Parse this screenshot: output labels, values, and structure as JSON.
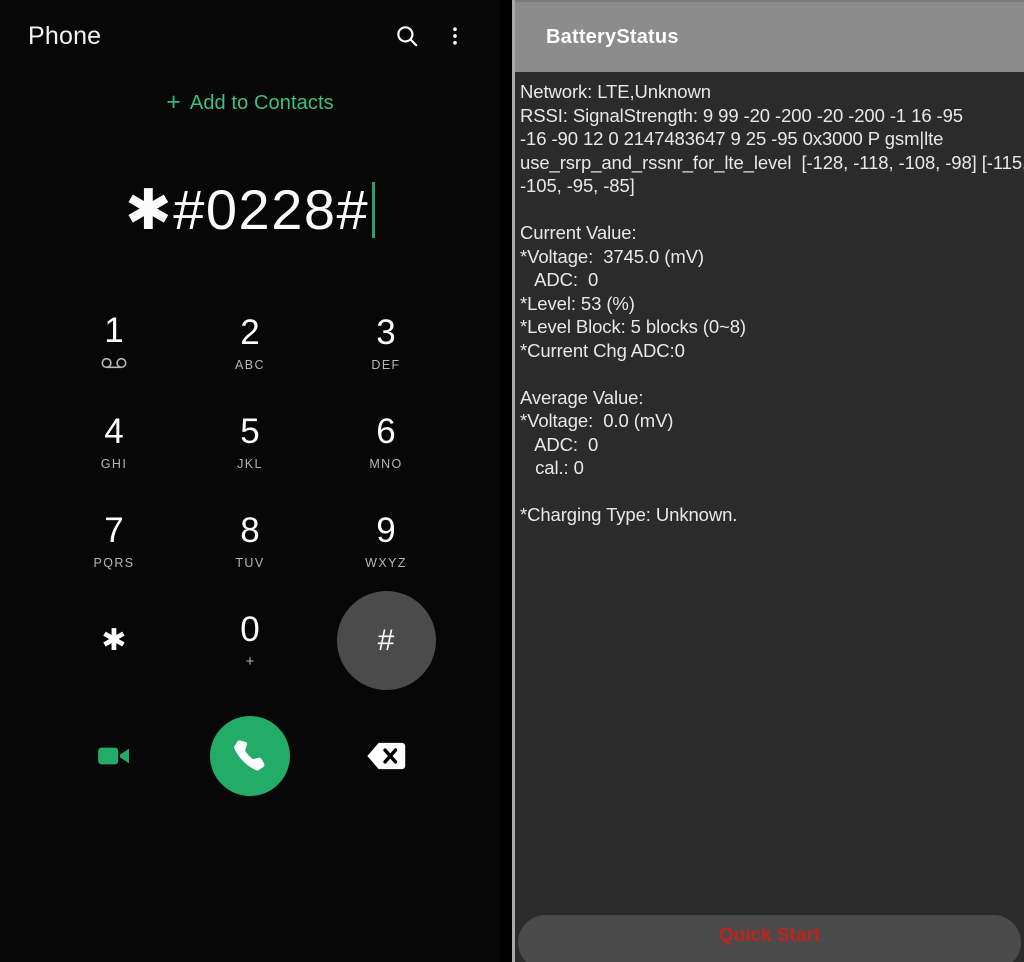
{
  "phone_app": {
    "title": "Phone",
    "search_icon": "search-icon",
    "overflow_icon": "more-vert-icon",
    "add_to_contacts": {
      "plus": "+",
      "label": "Add to Contacts"
    },
    "dial_display": {
      "number": "✱#0228#",
      "cursor_color": "#2e9e6b"
    },
    "keypad": [
      {
        "digit": "1",
        "sub": "",
        "icon": "voicemail-icon",
        "pressed": false
      },
      {
        "digit": "2",
        "sub": "ABC",
        "icon": "",
        "pressed": false
      },
      {
        "digit": "3",
        "sub": "DEF",
        "icon": "",
        "pressed": false
      },
      {
        "digit": "4",
        "sub": "GHI",
        "icon": "",
        "pressed": false
      },
      {
        "digit": "5",
        "sub": "JKL",
        "icon": "",
        "pressed": false
      },
      {
        "digit": "6",
        "sub": "MNO",
        "icon": "",
        "pressed": false
      },
      {
        "digit": "7",
        "sub": "PQRS",
        "icon": "",
        "pressed": false
      },
      {
        "digit": "8",
        "sub": "TUV",
        "icon": "",
        "pressed": false
      },
      {
        "digit": "9",
        "sub": "WXYZ",
        "icon": "",
        "pressed": false
      },
      {
        "digit": "✱",
        "sub": "",
        "icon": "",
        "pressed": false
      },
      {
        "digit": "0",
        "sub": "+",
        "icon": "",
        "pressed": false
      },
      {
        "digit": "#",
        "sub": "",
        "icon": "",
        "pressed": true
      }
    ],
    "actions": {
      "video_call_icon": "video-camera-icon",
      "call_icon": "phone-handset-icon",
      "backspace_icon": "backspace-icon",
      "call_button_color": "#23ab68",
      "video_icon_color": "#23ab68"
    }
  },
  "battery_app": {
    "title": "BatteryStatus",
    "report_lines": [
      "Network: LTE,Unknown",
      "RSSI: SignalStrength: 9 99 -20 -200 -20 -200 -1 16 -95",
      "-16 -90 12 0 2147483647 9 25 -95 0x3000 P gsm|lte",
      "use_rsrp_and_rssnr_for_lte_level  [-128, -118, -108, -98] [-115,",
      "-105, -95, -85]",
      "",
      "Current Value:",
      "*Voltage:  3745.0 (mV)",
      "   ADC:  0",
      "*Level: 53 (%)",
      "*Level Block: 5 blocks (0~8)",
      "*Current Chg ADC:0",
      "",
      "Average Value:",
      "*Voltage:  0.0 (mV)",
      "   ADC:  0",
      "   cal.: 0",
      "",
      "*Charging Type: Unknown."
    ],
    "quick_start": {
      "label": "Quick Start",
      "text_color": "#c0221c"
    }
  }
}
